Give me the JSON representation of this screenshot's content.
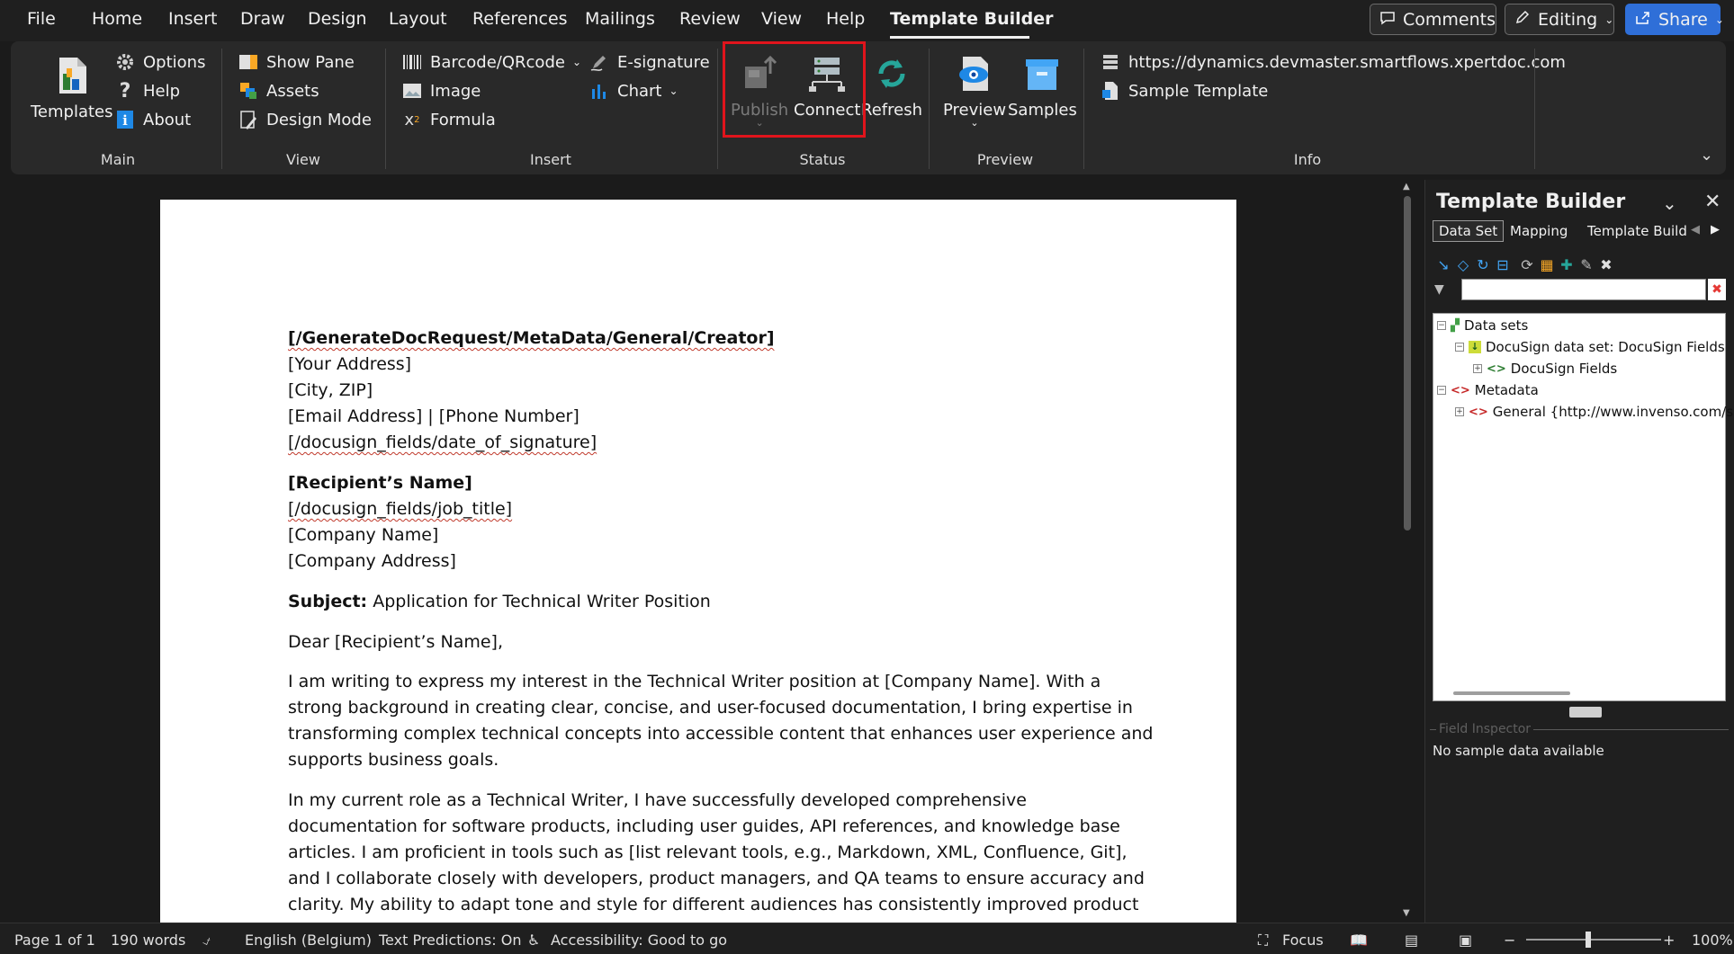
{
  "menu": {
    "items": [
      "File",
      "Home",
      "Insert",
      "Draw",
      "Design",
      "Layout",
      "References",
      "Mailings",
      "Review",
      "View",
      "Help",
      "Template Builder"
    ],
    "active": "Template Builder"
  },
  "top_right": {
    "comments": "Comments",
    "editing": "Editing",
    "share": "Share"
  },
  "ribbon": {
    "main": {
      "templates": "Templates",
      "options": "Options",
      "help": "Help",
      "about": "About",
      "label": "Main"
    },
    "view": {
      "show_pane": "Show Pane",
      "assets": "Assets",
      "design_mode": "Design Mode",
      "label": "View"
    },
    "insert": {
      "barcode": "Barcode/QRcode",
      "image": "Image",
      "formula": "Formula",
      "esignature": "E-signature",
      "chart": "Chart",
      "label": "Insert"
    },
    "status": {
      "publish": "Publish",
      "connect": "Connect",
      "refresh": "Refresh",
      "label": "Status"
    },
    "preview": {
      "preview": "Preview",
      "samples": "Samples",
      "label": "Preview"
    },
    "info": {
      "url": "https://dynamics.devmaster.smartflows.xpertdoc.com",
      "sample_template": "Sample Template",
      "label": "Info"
    }
  },
  "document": {
    "creator": "[/GenerateDocRequest/MetaData/General/Creator]",
    "address": "[Your Address]",
    "city": "[City, ZIP]",
    "contact": "[Email Address] | [Phone Number]",
    "date": "[/docusign_fields/date_of_signature]",
    "recipient": "[Recipient’s Name]",
    "job_title": "[/docusign_fields/job_title]",
    "company": "[Company Name]",
    "company_address": "[Company Address]",
    "subject_label": "Subject:",
    "subject_text": " Application for Technical Writer Position",
    "salutation": "Dear [Recipient’s Name],",
    "p1_l1": "I am writing to express my interest in the Technical Writer position at [Company Name]. With a",
    "p1_l2": "strong background in creating clear, concise, and user-focused documentation, I bring expertise in",
    "p1_l3": "transforming complex technical concepts into accessible content that enhances user experience and",
    "p1_l4": "supports business goals.",
    "p2_l1": "In my current role as a Technical Writer, I have successfully developed comprehensive",
    "p2_l2": "documentation for software products, including user guides, API references, and knowledge base",
    "p2_l3": "articles. I am proficient in tools such as [list relevant tools, e.g., Markdown, XML, Confluence, Git],",
    "p2_l4": "and I collaborate closely with developers, product managers, and QA teams to ensure accuracy and",
    "p2_l5": "clarity. My ability to adapt tone and style for different audiences has consistently improved product"
  },
  "panel": {
    "title": "Template Builder",
    "tabs": [
      "Data Set",
      "Mapping",
      "Template Build"
    ],
    "tree": {
      "data_sets": "Data sets",
      "docusign_set": "DocuSign data set: DocuSign Fields",
      "docusign_fields": "DocuSign Fields",
      "metadata": "Metadata",
      "general": "General {http://www.invenso.com/s"
    },
    "field_inspector": "Field Inspector",
    "no_sample": "No sample data available"
  },
  "status": {
    "page": "Page 1 of 1",
    "words": "190 words",
    "language": "English (Belgium)",
    "predictions": "Text Predictions: On",
    "accessibility": "Accessibility: Good to go",
    "focus": "Focus",
    "zoom": "100%"
  }
}
